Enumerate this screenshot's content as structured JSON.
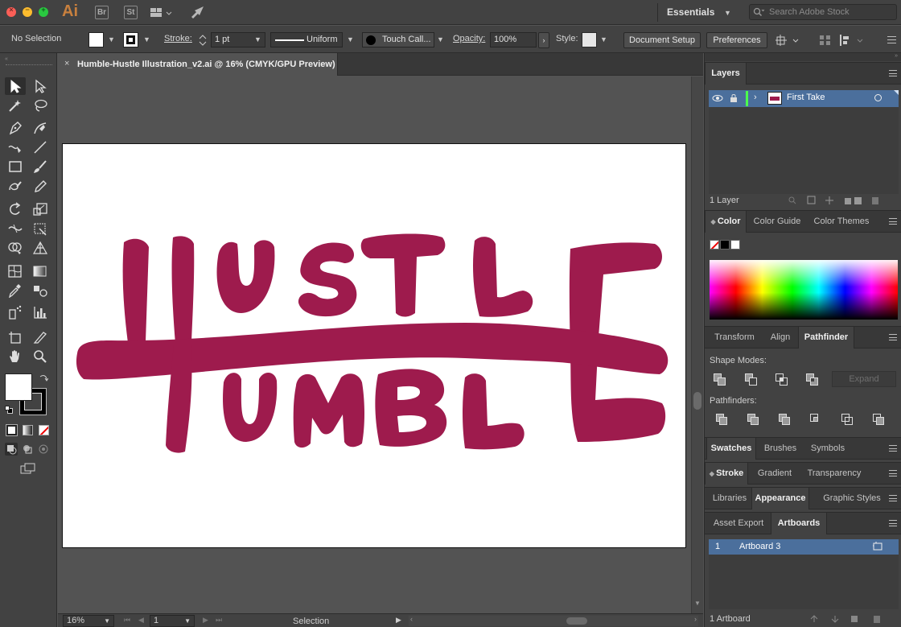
{
  "app": {
    "logo": "Ai",
    "bridge": "Br",
    "stock": "St"
  },
  "workspace": {
    "label": "Essentials"
  },
  "search": {
    "placeholder": "Search Adobe Stock"
  },
  "control": {
    "selection_label": "No Selection",
    "stroke_label": "Stroke:",
    "stroke_weight": "1 pt",
    "profile": "Uniform",
    "brush": "Touch Call...",
    "opacity_label": "Opacity:",
    "opacity_value": "100%",
    "style_label": "Style:",
    "document_setup": "Document Setup",
    "preferences": "Preferences"
  },
  "document": {
    "tab_title": "Humble-Hustle Illustration_v2.ai @ 16% (CMYK/GPU Preview)"
  },
  "artwork": {
    "color": "#9e1b4d",
    "top_word": "HUSTLE",
    "bottom_word": "HUMBLE"
  },
  "status": {
    "zoom": "16%",
    "artboard_num": "1",
    "tool": "Selection"
  },
  "layers": {
    "tab": "Layers",
    "rows": [
      {
        "name": "First Take"
      }
    ],
    "count": "1 Layer"
  },
  "color_panel": {
    "tabs": [
      "Color",
      "Color Guide",
      "Color Themes"
    ]
  },
  "transform_panel": {
    "tabs": [
      "Transform",
      "Align",
      "Pathfinder"
    ],
    "shape_modes": "Shape Modes:",
    "expand": "Expand",
    "pathfinders": "Pathfinders:"
  },
  "swatches_panel": {
    "tabs": [
      "Swatches",
      "Brushes",
      "Symbols"
    ]
  },
  "stroke_panel": {
    "tabs": [
      "Stroke",
      "Gradient",
      "Transparency"
    ]
  },
  "libraries_panel": {
    "tabs": [
      "Libraries",
      "Appearance",
      "Graphic Styles"
    ]
  },
  "artboards_panel": {
    "tabs": [
      "Asset Export",
      "Artboards"
    ],
    "rows": [
      {
        "num": "1",
        "name": "Artboard 3"
      }
    ],
    "count": "1 Artboard"
  }
}
